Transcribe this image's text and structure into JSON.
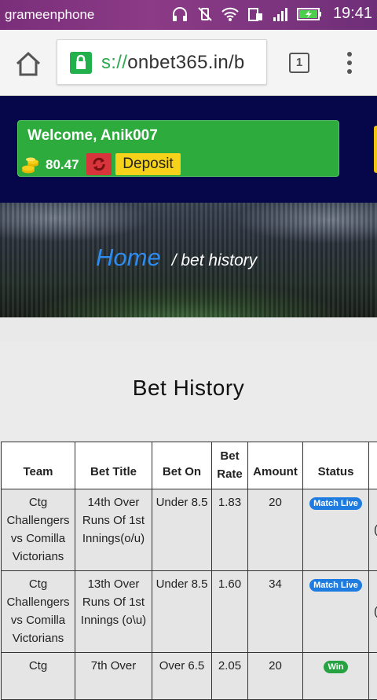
{
  "status_bar": {
    "carrier": "grameenphone",
    "time": "19:41"
  },
  "browser": {
    "url_scheme": "s://",
    "url_host": "onbet365.in/b",
    "tab_count": "1"
  },
  "header": {
    "welcome": "Welcome, Anik007",
    "balance": "80.47",
    "deposit_label": "Deposit"
  },
  "hero": {
    "home_link": "Home",
    "crumb": "/ bet history"
  },
  "page": {
    "title": "Bet History"
  },
  "table": {
    "columns": [
      "Team",
      "Bet Title",
      "Bet On",
      "Bet Rate",
      "Amount",
      "Status"
    ],
    "rows": [
      {
        "team": "Ctg Challengers vs Comilla Victorians",
        "title": "14th Over Runs Of 1st Innings(o/u)",
        "bet_on": "Under 8.5",
        "rate": "1.83",
        "amount": "20",
        "status": "Match Live",
        "extra": "("
      },
      {
        "team": "Ctg Challengers vs Comilla Victorians",
        "title": "13th Over Runs Of 1st Innings (o\\u)",
        "bet_on": "Under 8.5",
        "rate": "1.60",
        "amount": "34",
        "status": "Match Live",
        "extra": "("
      },
      {
        "team": "Ctg",
        "title": "7th Over",
        "bet_on": "Over 6.5",
        "rate": "2.05",
        "amount": "20",
        "status": "Win",
        "extra": ""
      }
    ]
  },
  "colors": {
    "welcome_green": "#2dab3c",
    "deposit_yellow": "#f6d21a",
    "refresh_red": "#d8343c",
    "status_live": "#1e7ce0",
    "status_win": "#27a243"
  }
}
